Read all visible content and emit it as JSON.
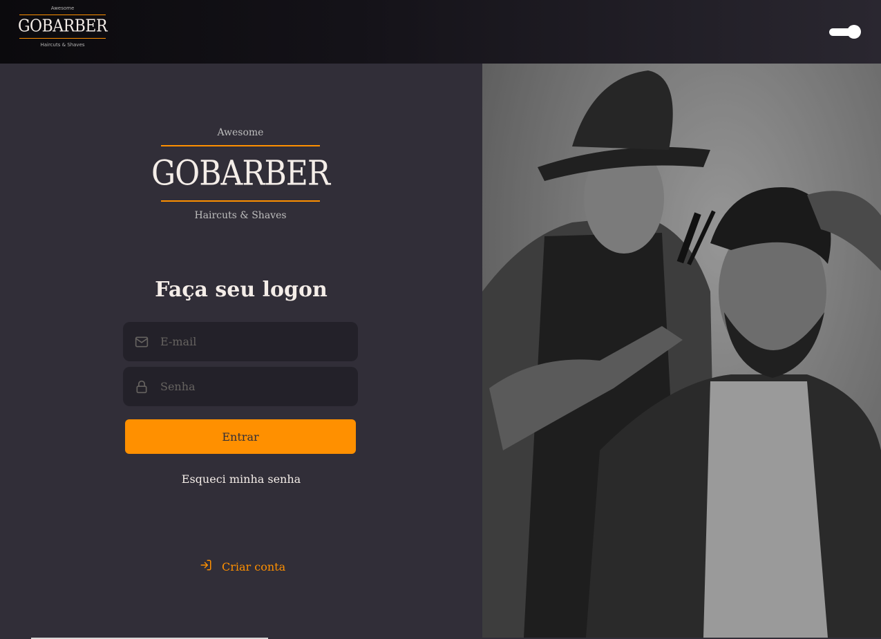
{
  "header": {
    "logo": {
      "top": "Awesome",
      "name": "GOBARBER",
      "tagline": "Haircuts & Shaves"
    },
    "theme_toggle": {
      "state": "on"
    }
  },
  "brand": {
    "top": "Awesome",
    "name": "GOBARBER",
    "tagline": "Haircuts & Shaves"
  },
  "form": {
    "title": "Faça seu logon",
    "email_placeholder": "E-mail",
    "password_placeholder": "Senha",
    "submit_label": "Entrar",
    "forgot_label": "Esqueci minha senha"
  },
  "footer": {
    "create_account_label": "Criar conta"
  },
  "colors": {
    "accent": "#ff9000",
    "background": "#312e38",
    "input": "#232129",
    "text": "#f4ede8",
    "placeholder": "#666360"
  },
  "icons": {
    "email": "mail-icon",
    "password": "lock-icon",
    "create_account": "log-in-icon"
  }
}
